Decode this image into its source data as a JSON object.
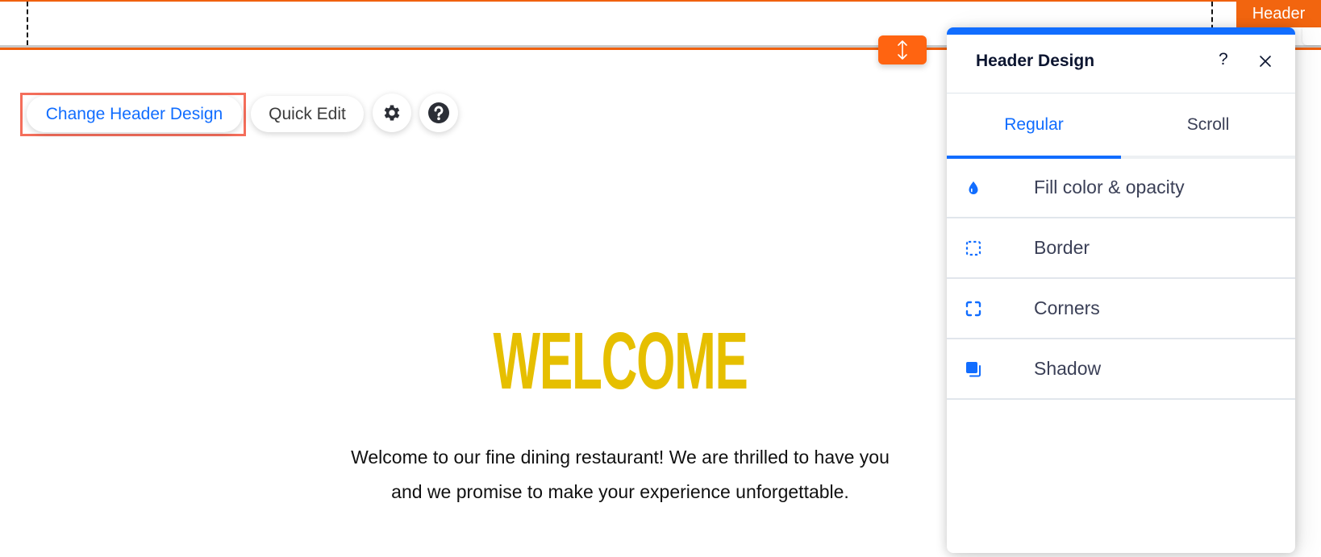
{
  "header": {
    "tag_label": "Header"
  },
  "toolbar": {
    "change_design_label": "Change Header Design",
    "quick_edit_label": "Quick Edit",
    "settings_icon": "gear-icon",
    "help_icon": "question-circle-icon"
  },
  "content": {
    "title": "WELCOME",
    "paragraph": "Welcome to our fine dining restaurant! We are thrilled to have you and we promise to make your experience unforgettable."
  },
  "panel": {
    "title": "Header Design",
    "help_label": "?",
    "tabs": [
      {
        "label": "Regular",
        "active": true
      },
      {
        "label": "Scroll",
        "active": false
      }
    ],
    "items": [
      {
        "label": "Fill color & opacity",
        "icon": "droplet-icon"
      },
      {
        "label": "Border",
        "icon": "dashed-square-icon"
      },
      {
        "label": "Corners",
        "icon": "corners-icon"
      },
      {
        "label": "Shadow",
        "icon": "shadow-icon"
      }
    ]
  },
  "colors": {
    "accent": "#116DFF",
    "editor_orange": "#F0610E",
    "highlight": "#F46E5B",
    "title_yellow": "#E6BF00"
  }
}
